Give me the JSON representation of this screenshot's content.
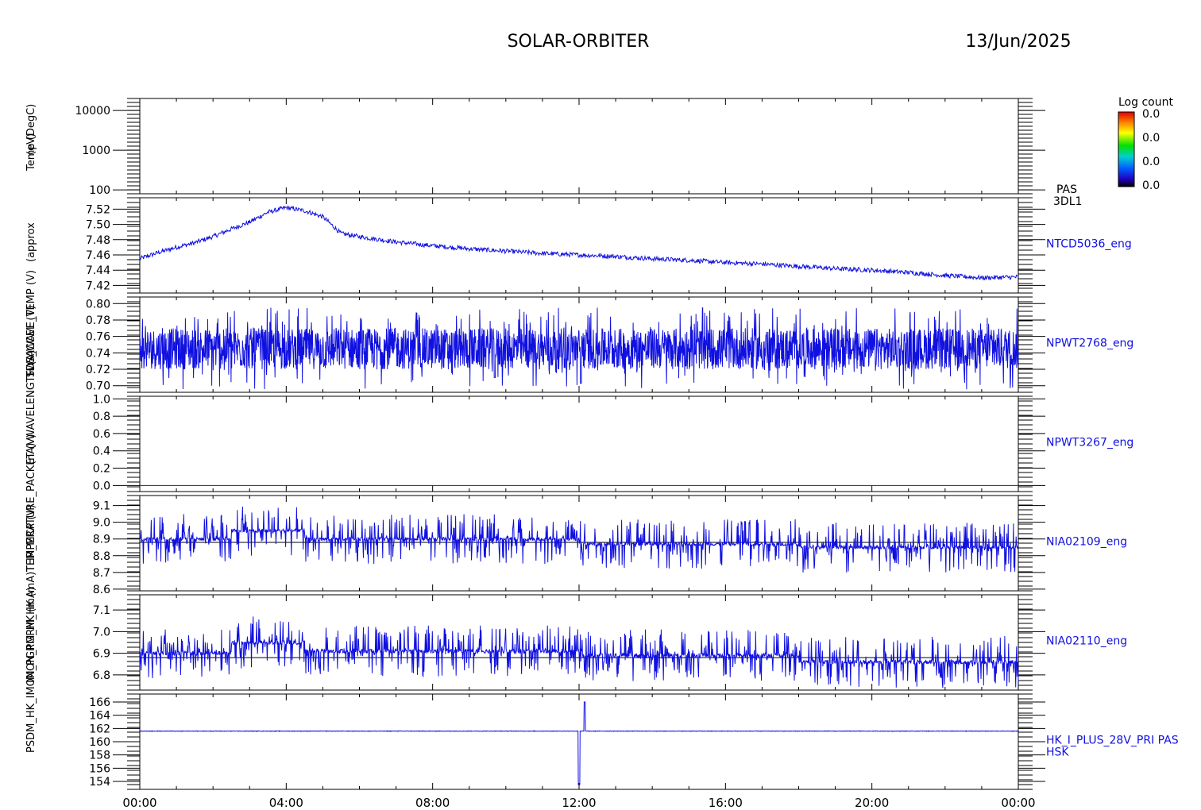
{
  "header": {
    "mission": "SOLAR-ORBITER",
    "date": "13/Jun/2025"
  },
  "colorbar": {
    "title": "Log count",
    "ticks": [
      "0.0",
      "0.0",
      "0.0",
      "0.0"
    ]
  },
  "left_labels": [
    "(eV)",
    "Temp (DegC)",
    "(approx",
    "TDS_WAVE_TEMP (V)",
    "SW-ACCEL (V)",
    "(nA) WAVELENGTH (A)",
    "TEMPERATURE_PACKET (V)",
    "THR_MCP (V)",
    "IMON_PGRM_HK (mA)",
    "PSDM_HK_IMON_PGRM_HK (mA)"
  ],
  "time_axis": {
    "ticks": [
      "00:00",
      "04:00",
      "08:00",
      "12:00",
      "16:00",
      "20:00",
      "00:00"
    ],
    "range_hours": [
      0,
      24
    ]
  },
  "chart_data": [
    {
      "type": "heatmap",
      "ylog": true,
      "ylim": [
        80,
        20000
      ],
      "yticks": [
        "10000",
        "1000",
        "100"
      ],
      "ytick_values": [
        10000,
        1000,
        100
      ],
      "right_label": [
        "PAS",
        "3DL1"
      ],
      "values": []
    },
    {
      "type": "line",
      "right_label": [
        "NTCD5036_eng"
      ],
      "ylim": [
        7.41,
        7.535
      ],
      "yticks": [
        "7.52",
        "7.50",
        "7.48",
        "7.46",
        "7.44",
        "7.42"
      ],
      "ytick_values": [
        7.52,
        7.5,
        7.48,
        7.46,
        7.44,
        7.42
      ],
      "series": [
        {
          "x": [
            0,
            0.5,
            1,
            1.5,
            2,
            2.5,
            3,
            3.5,
            4,
            4.5,
            5,
            5.5,
            6,
            7,
            8,
            9,
            10,
            11,
            12,
            13,
            14,
            15,
            16,
            17,
            18,
            19,
            20,
            21,
            22,
            23,
            24
          ],
          "y": [
            7.455,
            7.463,
            7.47,
            7.476,
            7.484,
            7.494,
            7.503,
            7.516,
            7.522,
            7.518,
            7.51,
            7.488,
            7.484,
            7.477,
            7.472,
            7.468,
            7.465,
            7.462,
            7.46,
            7.458,
            7.455,
            7.453,
            7.45,
            7.448,
            7.445,
            7.442,
            7.44,
            7.437,
            7.433,
            7.43,
            7.431
          ]
        }
      ]
    },
    {
      "type": "line",
      "right_label": [
        "NPWT2768_eng"
      ],
      "ylim": [
        0.692,
        0.808
      ],
      "yticks": [
        "0.80",
        "0.78",
        "0.76",
        "0.74",
        "0.72",
        "0.70"
      ],
      "ytick_values": [
        0.8,
        0.78,
        0.76,
        0.74,
        0.72,
        0.7
      ],
      "series": [
        {
          "baseline": 0.745,
          "amplitude": 0.05,
          "spikes": [
            {
              "x": 9.7,
              "y": 0.71
            },
            {
              "x": 12.05,
              "y": 0.703
            }
          ]
        }
      ]
    },
    {
      "type": "line",
      "right_label": [
        "NPWT3267_eng"
      ],
      "ylim": [
        -0.07,
        1.03
      ],
      "yticks": [
        "1.0",
        "0.8",
        "0.6",
        "0.4",
        "0.2",
        "0.0"
      ],
      "ytick_values": [
        1.0,
        0.8,
        0.6,
        0.4,
        0.2,
        0.0
      ],
      "series": [
        {
          "x": [
            0,
            24
          ],
          "y": [
            0,
            0
          ]
        }
      ]
    },
    {
      "type": "line",
      "right_label": [
        "NIA02109_eng"
      ],
      "ylim": [
        8.59,
        9.16
      ],
      "yticks": [
        "9.1",
        "9.0",
        "8.9",
        "8.8",
        "8.7",
        "8.6"
      ],
      "ytick_values": [
        9.1,
        9.0,
        8.9,
        8.8,
        8.7,
        8.6
      ],
      "series": [
        {
          "levels": [
            {
              "x0": 0,
              "x1": 2.5,
              "y": 8.9
            },
            {
              "x0": 2.5,
              "x1": 4.5,
              "y": 8.95
            },
            {
              "x0": 4.5,
              "x1": 12,
              "y": 8.9
            },
            {
              "x0": 12,
              "x1": 18,
              "y": 8.87
            },
            {
              "x0": 18,
              "x1": 24,
              "y": 8.85
            }
          ],
          "amplitude": 0.15,
          "reference_line": 8.88
        }
      ]
    },
    {
      "type": "line",
      "right_label": [
        "NIA02110_eng"
      ],
      "ylim": [
        6.73,
        7.17
      ],
      "yticks": [
        "7.1",
        "7.0",
        "6.9",
        "6.8"
      ],
      "ytick_values": [
        7.1,
        7.0,
        6.9,
        6.8
      ],
      "series": [
        {
          "levels": [
            {
              "x0": 0,
              "x1": 2.5,
              "y": 6.9
            },
            {
              "x0": 2.5,
              "x1": 4.5,
              "y": 6.95
            },
            {
              "x0": 4.5,
              "x1": 12,
              "y": 6.91
            },
            {
              "x0": 12,
              "x1": 18,
              "y": 6.89
            },
            {
              "x0": 18,
              "x1": 24,
              "y": 6.86
            }
          ],
          "amplitude": 0.12,
          "reference_line": 6.88
        }
      ]
    },
    {
      "type": "line",
      "right_label": [
        "HK_I_PLUS_28V_PRI PAS",
        "HSK"
      ],
      "ylim": [
        152.8,
        167.2
      ],
      "yticks": [
        "166",
        "164",
        "162",
        "160",
        "158",
        "156",
        "154"
      ],
      "ytick_values": [
        166,
        164,
        162,
        160,
        158,
        156,
        154
      ],
      "series": [
        {
          "baseline": 161.6,
          "amplitude": 0.25,
          "spikes": [
            {
              "x": 12.0,
              "y": 153.5
            },
            {
              "x": 12.15,
              "y": 166.0
            }
          ]
        }
      ]
    }
  ]
}
